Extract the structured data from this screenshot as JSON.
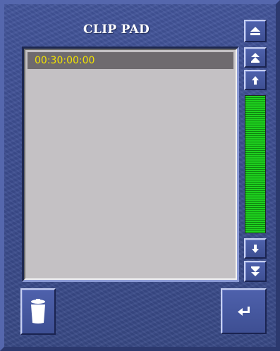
{
  "panel": {
    "title": "CLIP PAD"
  },
  "clip_list": {
    "items": [
      {
        "timecode": "00:30:00:00",
        "selected": true
      }
    ]
  },
  "controls": {
    "eject": {
      "icon": "eject-icon"
    },
    "scroll_top": {
      "icon": "double-up-arrow-icon"
    },
    "scroll_up": {
      "icon": "up-arrow-icon"
    },
    "scroll_down": {
      "icon": "down-arrow-icon"
    },
    "scroll_bottom": {
      "icon": "double-down-arrow-icon"
    },
    "delete": {
      "icon": "trash-icon"
    },
    "enter": {
      "icon": "return-arrow-icon"
    }
  },
  "level_meter": {
    "fill_fraction": 1.0,
    "color": "#1ed21e"
  },
  "colors": {
    "panel_bg": "#3c4d90",
    "list_bg": "#c4c1c4",
    "selected_row_bg": "#6e6a6e",
    "selected_row_text": "#f2e200"
  }
}
